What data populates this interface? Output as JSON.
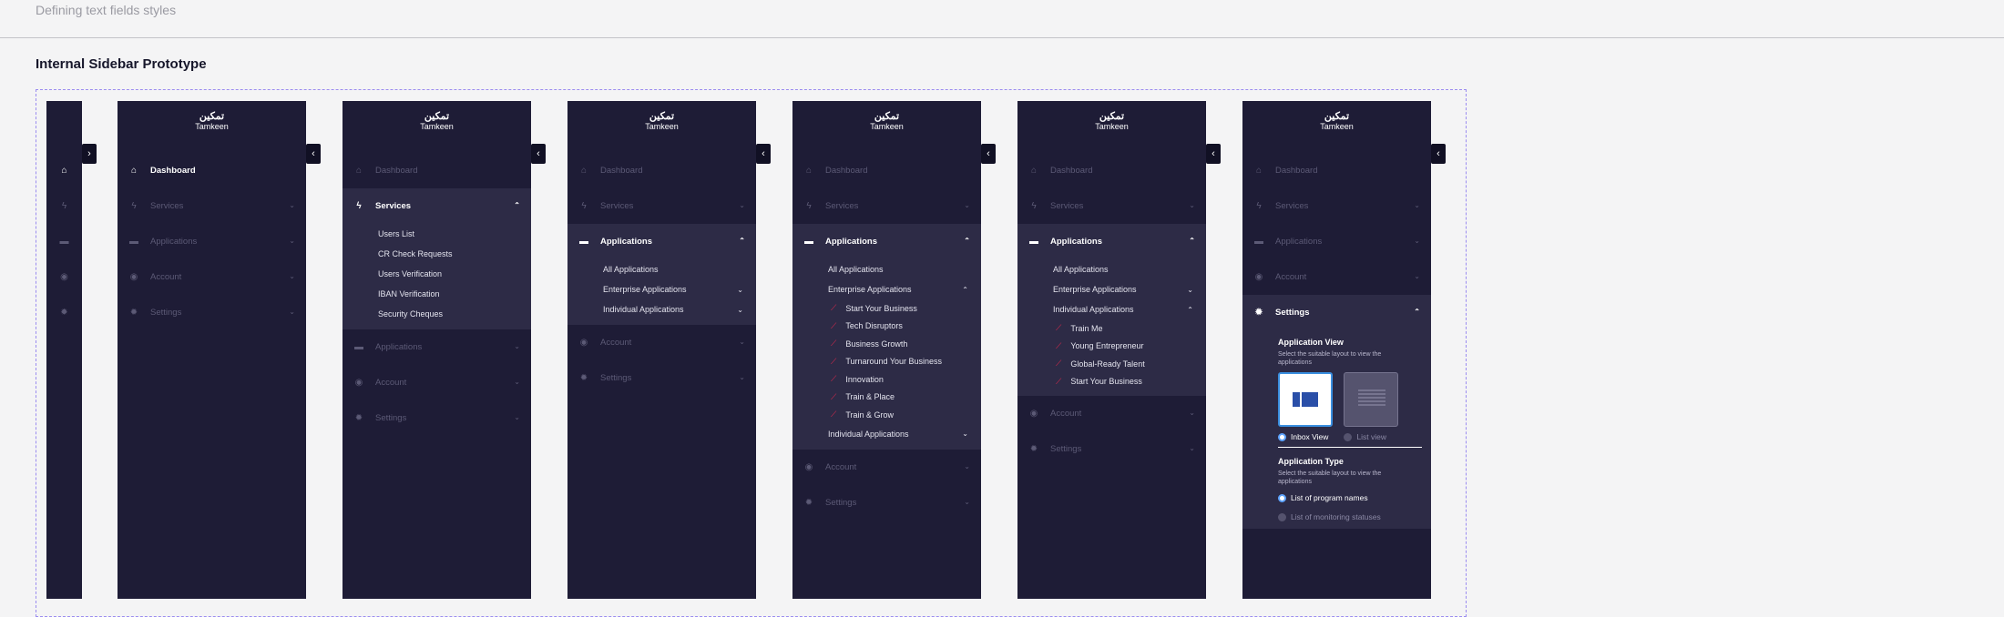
{
  "page": {
    "top_title": "Defining text fields styles",
    "section_title": "Internal Sidebar Prototype"
  },
  "logo": {
    "arabic": "تمكين",
    "english": "Tamkeen"
  },
  "toggle": {
    "expand": "›",
    "collapse": "‹"
  },
  "menu": {
    "dashboard": "Dashboard",
    "services": "Services",
    "applications": "Applications",
    "account": "Account",
    "settings": "Settings"
  },
  "services_sub": [
    "Users List",
    "CR Check Requests",
    "Users Verification",
    "IBAN Verification",
    "Security Cheques"
  ],
  "applications_sub": {
    "all": "All Applications",
    "enterprise": "Enterprise Applications",
    "individual": "Individual Applications"
  },
  "enterprise_sub": [
    "Start Your Business",
    "Tech Disruptors",
    "Business Growth",
    "Turnaround Your Business",
    "Innovation",
    "Train & Place",
    "Train & Grow"
  ],
  "individual_sub": [
    "Train Me",
    "Young Entrepreneur",
    "Global-Ready Talent",
    "Start Your Business"
  ],
  "settings_panel": {
    "view_heading": "Application View",
    "view_desc": "Select the suitable layout to view the applications",
    "inbox_label": "Inbox View",
    "list_label": "List view",
    "type_heading": "Application Type",
    "type_desc": "Select the suitable layout to view the applications",
    "type_opt1": "List of program names",
    "type_opt2": "List of monitoring statuses"
  },
  "colors": {
    "sidebar": "#1e1c36",
    "group": "#2d2b46",
    "accent_red": "#e0284c",
    "accent_blue": "#3a8fe0"
  }
}
